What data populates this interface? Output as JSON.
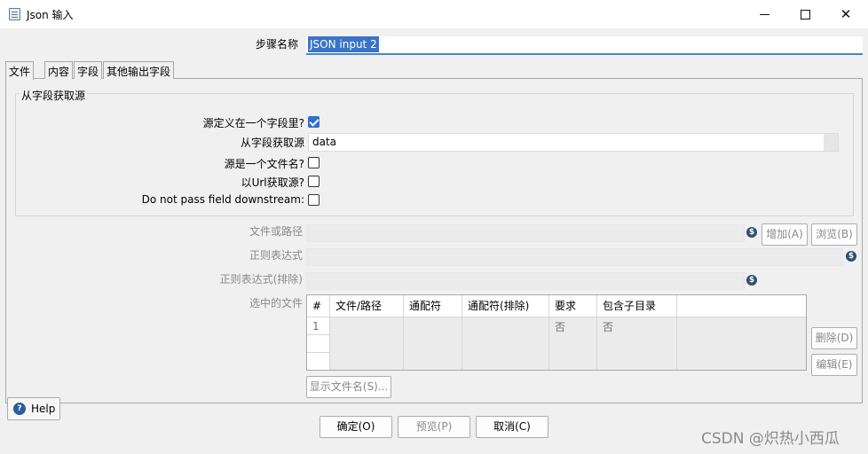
{
  "window": {
    "title": "Json 输入",
    "minimize": "",
    "maximize": "",
    "close": "✕"
  },
  "step": {
    "label": "步骤名称",
    "value": "JSON input 2"
  },
  "tabs": [
    {
      "label": "文件"
    },
    {
      "label": "内容"
    },
    {
      "label": "字段"
    },
    {
      "label": "其他输出字段"
    }
  ],
  "source_group": {
    "title": "从字段获取源",
    "source_in_field": {
      "label": "源定义在一个字段里?",
      "checked": true
    },
    "source_field": {
      "label": "从字段获取源",
      "value": "data"
    },
    "source_is_filename": {
      "label": "源是一个文件名?",
      "checked": false
    },
    "read_url": {
      "label": "以Url获取源?",
      "checked": false
    },
    "do_not_pass": {
      "label": "Do not pass field downstream:",
      "checked": false
    }
  },
  "file": {
    "path_label": "文件或路径",
    "add_button": "增加(A)",
    "browse_button": "浏览(B)",
    "regex_label": "正则表达式",
    "regex_exclude_label": "正则表达式(排除)",
    "selected_files_label": "选中的文件",
    "delete_button": "删除(D)",
    "edit_button": "编辑(E)",
    "show_filenames_button": "显示文件名(S)...",
    "var_icon": "$"
  },
  "table": {
    "columns": [
      "#",
      "文件/路径",
      "通配符",
      "通配符(排除)",
      "要求",
      "包含子目录"
    ],
    "rows": [
      {
        "num": "1",
        "path": "",
        "wildcard": "",
        "wildcard_exclude": "",
        "required": "否",
        "subdirs": "否"
      }
    ]
  },
  "footer": {
    "ok_button": "确定(O)",
    "preview_button": "预览(P)",
    "cancel_button": "取消(C)",
    "help_button": "Help",
    "help_icon": "?"
  },
  "watermark": "CSDN @炽热小西瓜"
}
